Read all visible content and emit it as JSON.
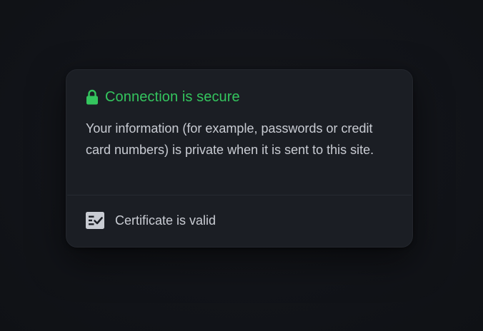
{
  "popup": {
    "title": "Connection is secure",
    "title_icon": "lock-icon",
    "description": "Your information (for example, passwords or credit card numbers) is private when it is sent to this site.",
    "certificate": {
      "label": "Certificate is valid",
      "icon": "certificate-icon"
    }
  },
  "colors": {
    "secure_green": "#34c55e",
    "panel_background": "#1b1e24",
    "page_background": "#121419",
    "text": "#c9ccd3"
  }
}
